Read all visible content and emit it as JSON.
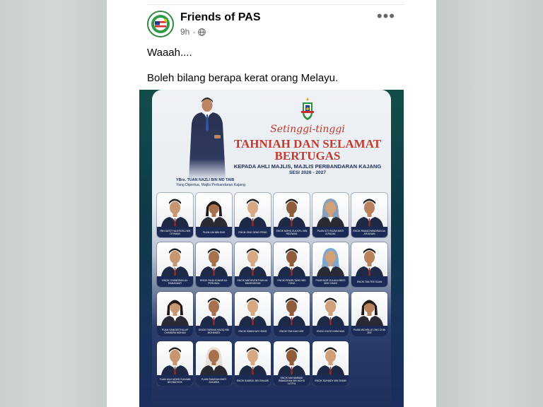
{
  "post": {
    "page_name": "Friends of PAS",
    "time": "9h",
    "privacy_icon": "globe-icon",
    "more_icon": "more-horizontal-icon",
    "text_line1": "Waaah....",
    "text_line2": "Boleh bilang berapa kerat orang Melayu."
  },
  "poster": {
    "script_title": "Setinggi-tinggi",
    "main_title": "TAHNIAH DAN SELAMAT BERTUGAS",
    "subtitle": "KEPADA AHLI MAJLIS, MAJLIS PERBANDARAN KAJANG",
    "session": "SESI 2026 - 2027",
    "leader_name": "YBrs. TUAN NAZLI BIN MD TAIB",
    "leader_role": "Yang Dipertua, Majlis Perbandaran Kajang",
    "members": [
      {
        "name": "YBH DATO' HAJI ROSLI BIN OTHMAN",
        "female": false
      },
      {
        "name": "PUAN LIM MIN ENG",
        "female": true
      },
      {
        "name": "ENCIK ONG SENG PENG",
        "female": false
      },
      {
        "name": "ENCIK MOHD ZULKIFLI BIN RIDZWAN",
        "female": false
      },
      {
        "name": "PUAN SITI RAZMI BINTI A.RAZAK",
        "female": true,
        "hijab": true
      },
      {
        "name": "ENCIK RAMACHANDRAN A/L ARJUNAN",
        "female": false
      },
      {
        "name": "ENCIK CHANDRAN A/L RAMASAMY",
        "female": false
      },
      {
        "name": "ENCIK RAJA KUMAR A/L PERUMAL",
        "female": false
      },
      {
        "name": "ENCIK MATHIVENTHAN A/L MAHENDRAN",
        "female": false
      },
      {
        "name": "ENCIK EDWIN TANG WEI YONG",
        "female": false
      },
      {
        "name": "PUAN NOR ZULAILA BINTI ABD GHANI",
        "female": true,
        "hijab": true
      },
      {
        "name": "ENCIK TAN TEE SUAN",
        "female": false
      },
      {
        "name": "PUAN SANGEETHA A/P CHANDRA MOHAN",
        "female": true
      },
      {
        "name": "ENCIK FARHAN HAZIQ BIN MOHAMED",
        "female": false
      },
      {
        "name": "ENCIK KWAN KAY HONG",
        "female": false
      },
      {
        "name": "ENCIK TAN KAH HOE",
        "female": false
      },
      {
        "name": "ENCIK KHOO KHIM HAN",
        "female": false
      },
      {
        "name": "PUAN MICHELLE ONG CHIN ZEE",
        "female": true
      },
      {
        "name": "TUAN HAJI MOHD SUHAIMI BIN BACHOK",
        "female": false
      },
      {
        "name": "PUAN RAMIYAH BINTI ZAKARIA",
        "female": true,
        "hijab": true
      },
      {
        "name": "ENCIK SAMSOL BIN SHAARI",
        "female": false
      },
      {
        "name": "ENCIK MUHAMMAD RAMADHAN BIN MOHD LUTFIA",
        "female": false
      },
      {
        "name": "ENCIK SUHAIDY BIN SHUIB",
        "female": false
      }
    ]
  }
}
